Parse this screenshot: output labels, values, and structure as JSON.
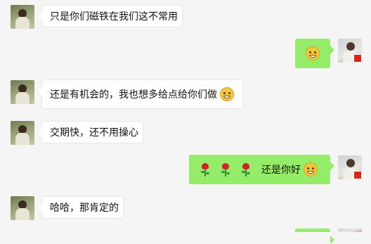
{
  "messages": [
    {
      "side": "left",
      "text": "只是你们磁铁在我们这不常用"
    },
    {
      "side": "right",
      "text": "",
      "emoji": "surprised-smile-emoji"
    },
    {
      "side": "left",
      "text": "还是有机会的，我也想多给点给你们做",
      "emoji": "grin-emoji"
    },
    {
      "side": "left",
      "text": "交期快，还不用操心"
    },
    {
      "side": "right",
      "roses": 3,
      "text": "还是你好",
      "emoji": "grin-emoji"
    },
    {
      "side": "left",
      "text": "哈哈，那肯定的"
    }
  ],
  "colors": {
    "background": "#f5f5f5",
    "incoming_bubble": "#ffffff",
    "outgoing_bubble": "#95ec69"
  }
}
